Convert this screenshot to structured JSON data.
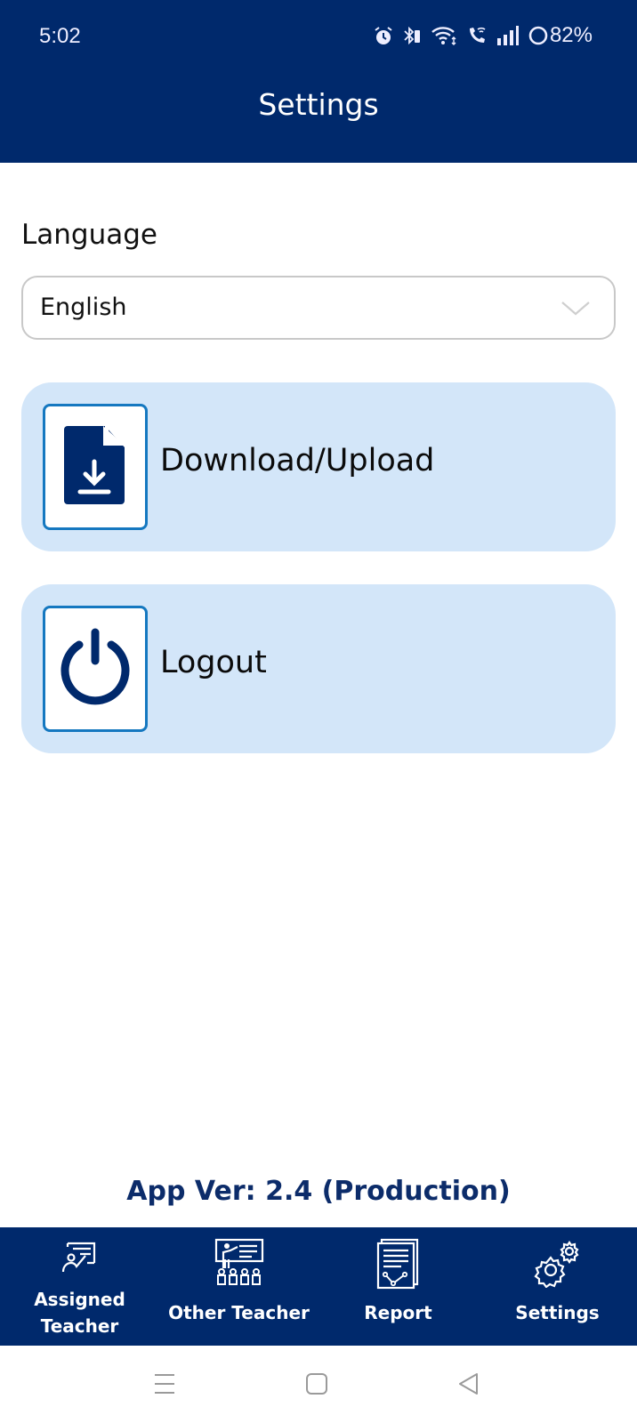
{
  "status_bar": {
    "time": "5:02",
    "battery": "82%",
    "icons": [
      "alarm-icon",
      "bluetooth-icon",
      "battery-saver-icon",
      "wifi-icon",
      "wifi-calling-icon",
      "signal-icon",
      "battery-ring-icon"
    ]
  },
  "header": {
    "title": "Settings"
  },
  "language": {
    "label": "Language",
    "selected": "English",
    "icon": "chevron-down-icon"
  },
  "actions": [
    {
      "label": "Download/Upload",
      "icon": "file-download-icon"
    },
    {
      "label": "Logout",
      "icon": "power-icon"
    }
  ],
  "app_version": "App Ver: 2.4 (Production)",
  "bottom_nav": {
    "items": [
      {
        "label": "Assigned Teacher",
        "line1": "Assigned",
        "line2": "Teacher",
        "icon": "teacher-board-icon"
      },
      {
        "label": "Other Teacher",
        "icon": "classroom-icon"
      },
      {
        "label": "Report",
        "icon": "report-icon"
      },
      {
        "label": "Settings",
        "icon": "gears-icon",
        "active": true
      }
    ]
  },
  "system_nav": [
    "recents-icon",
    "home-icon",
    "back-icon"
  ],
  "colors": {
    "primary": "#00296c",
    "card_bg": "#d3e6f9",
    "icon_border": "#1578c0",
    "version_text": "#0c2c6a"
  }
}
